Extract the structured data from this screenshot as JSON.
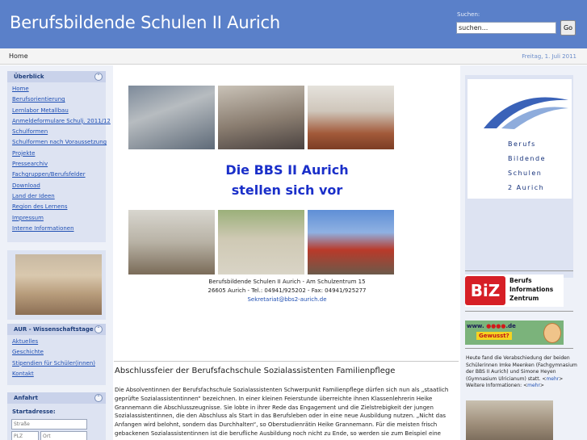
{
  "header": {
    "site_title": "Berufsbildende Schulen II Aurich",
    "search_label": "Suchen:",
    "search_value": "suchen...",
    "search_button": "Go"
  },
  "breadcrumb": {
    "home": "Home",
    "date": "Freitag, 1. Juli 2011"
  },
  "sidebar": {
    "overview_title": "Überblick",
    "overview_items": [
      "Home",
      "Berufsorientierung",
      "Lernlabor Metallbau",
      "Anmeldeformulare Schulj. 2011/12",
      "Schulformen",
      "Schulformen nach Voraussetzung",
      "Projekte",
      "Pressearchiv",
      "Fachgruppen/Berufsfelder",
      "Download",
      "Land der Ideen",
      "Region des Lernens",
      "Impressum",
      "Interne Informationen"
    ],
    "aur_title": "AUR - Wissenschaftstage",
    "aur_items": [
      "Aktuelles",
      "Geschichte",
      "Stipendien für Schüler(innen)",
      "Kontakt"
    ],
    "directions_title": "Anfahrt",
    "start_address_label": "Startadresse:",
    "street_placeholder": "Straße",
    "zip_placeholder": "PLZ",
    "city_placeholder": "Ort",
    "toggle_glyph": "⌃"
  },
  "main": {
    "headline_line1": "Die BBS II Aurich",
    "headline_line2": "stellen sich vor",
    "address_line1": "Berufsbildende Schulen II Aurich - Am Schulzentrum 15",
    "address_line2": "26605 Aurich - Tel.: 04941/925202 - Fax: 04941/925277",
    "email": "Sekretariat@bbs2-aurich.de",
    "news_title": "Abschlussfeier der Berufsfachschule Sozialassistenten Familienpflege",
    "news_text": "Die Absolventinnen der Berufsfachschule Sozialassistenten Schwerpunkt Familienpflege dürfen sich nun als „staatlich geprüfte Sozialassistentinnen“ bezeichnen. In einer kleinen Feierstunde überreichte ihnen Klassenlehrerin Heike Grannemann die Abschlusszeugnisse. Sie lobte in ihrer Rede das Engagement  und die Zielstrebigkeit der jungen Sozialassistentinnen, die den Abschluss als Start in das Berufsleben oder in eine neue Ausbildung nutzen. „Nicht das Anfangen wird belohnt, sondern das Durchhalten“, so Oberstudienrätin Heike Grannemann. Für die meisten frisch gebackenen Sozialassistentinnen ist die berufliche Ausbildung noch nicht zu Ende, so werden sie zum Beispiel eine"
  },
  "right": {
    "logo_words": [
      "Berufs",
      "Bildende",
      "Schulen",
      "2 Aurich"
    ],
    "biz_mark": "BiZ",
    "biz_lines": [
      "Berufs",
      "Informations",
      "Zentrum"
    ],
    "job_banner_top": "www.",
    "job_banner_domain": ".de",
    "job_banner_middle": "Gewusst?",
    "info_text": "Heute fand die Verabschiedung der beiden Schülerinnen Imke Meenken (Fachgymnasium der BBS II Aurich) und Simone Heyen (Gymnasium Ulricianum) statt. <",
    "info_link": "mehr",
    "info_after": ">",
    "more_info_label": "Weitere Informationen: <",
    "more_info_link": "mehr",
    "more_info_after": ">"
  }
}
